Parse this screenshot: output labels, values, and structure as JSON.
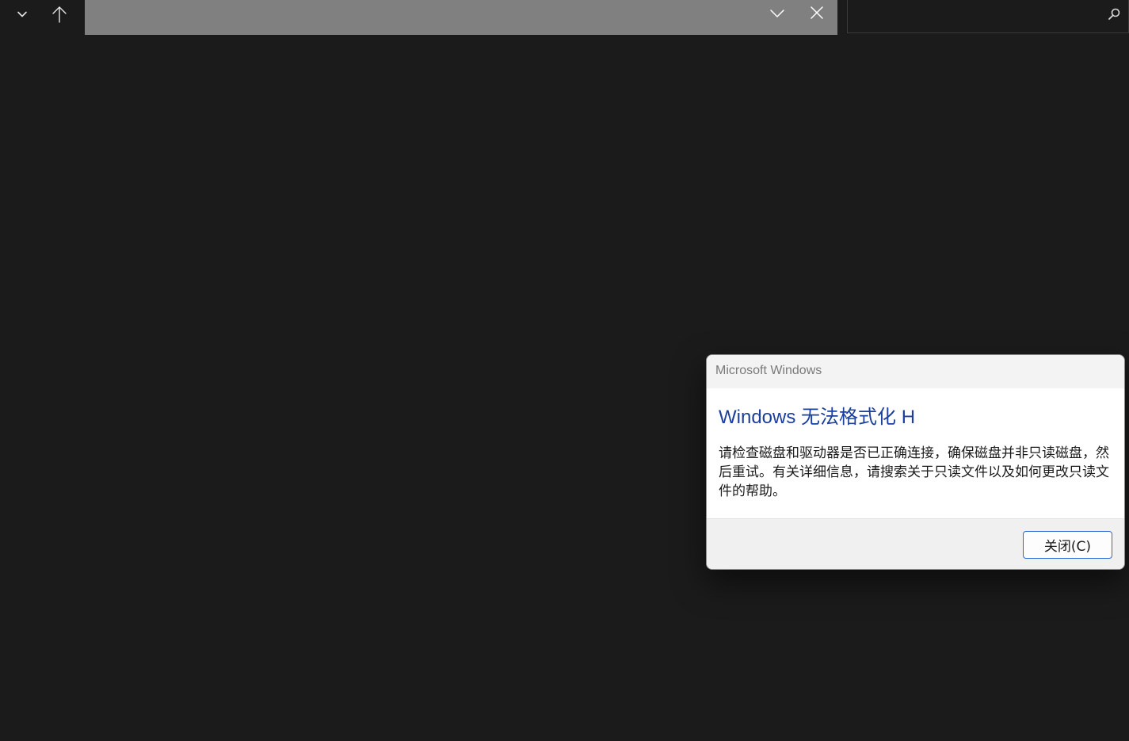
{
  "window": {
    "search": {
      "value": "",
      "placeholder": ""
    },
    "icons": {
      "recent": "chevron-down-icon",
      "up": "arrow-up-icon",
      "address_dropdown": "chevron-down-icon",
      "address_clear": "close-icon",
      "search": "search-icon"
    }
  },
  "dialog": {
    "title": "Microsoft Windows",
    "heading": "Windows 无法格式化 H",
    "message": "请检查磁盘和驱动器是否已正确连接，确保磁盘并非只读磁盘，然后重试。有关详细信息，请搜索关于只读文件以及如何更改只读文件的帮助。",
    "close_button": "关闭(C)"
  },
  "colors": {
    "background": "#1b1b1b",
    "address_bar": "#808080",
    "heading": "#1a3f9c",
    "button_border": "#2a6bd1"
  }
}
